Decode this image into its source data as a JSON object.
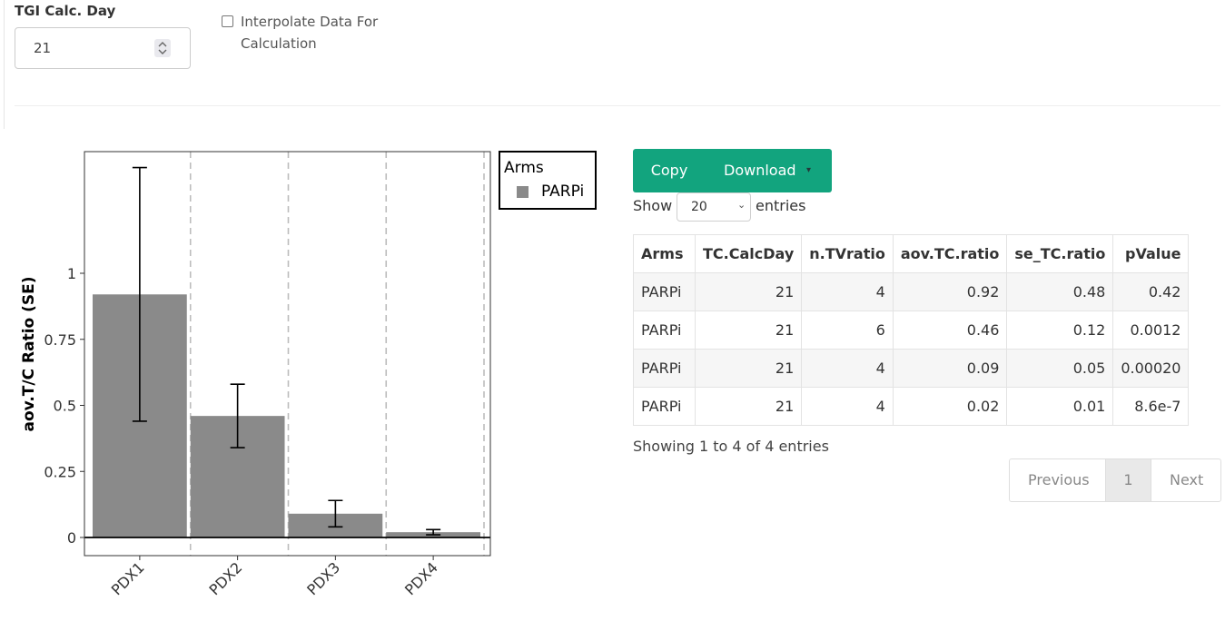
{
  "controls": {
    "tgi_label": "TGI Calc. Day",
    "tgi_value": "21",
    "interpolate_label": "Interpolate Data For Calculation",
    "interpolate_checked": false
  },
  "chart_data": {
    "type": "bar",
    "categories": [
      "PDX1",
      "PDX2",
      "PDX3",
      "PDX4"
    ],
    "series": [
      {
        "name": "PARPi",
        "values": [
          0.92,
          0.46,
          0.09,
          0.02
        ],
        "se": [
          0.48,
          0.12,
          0.05,
          0.01
        ],
        "color": "#8a8a8a"
      }
    ],
    "xlabel": "",
    "ylabel": "aov.T/C Ratio (SE)",
    "ylim": [
      -0.07,
      1.47
    ],
    "yticks": [
      0,
      0.25,
      0.5,
      0.75,
      1
    ],
    "ytick_labels": [
      "0",
      "0.25",
      "0.5",
      "0.75",
      "1"
    ],
    "grid": "dashed vertical",
    "legend": {
      "title": "Arms",
      "position": "top-right",
      "entries": [
        "PARPi"
      ]
    }
  },
  "buttons": {
    "copy": "Copy",
    "download": "Download",
    "caret": "▾"
  },
  "length_menu": {
    "show_label": "Show",
    "selected": "20",
    "chevron": "⌄",
    "entries_label": "entries"
  },
  "table": {
    "headers": [
      "Arms",
      "TC.CalcDay",
      "n.TVratio",
      "aov.TC.ratio",
      "se_TC.ratio",
      "pValue"
    ],
    "rows": [
      [
        "PARPi",
        "21",
        "4",
        "0.92",
        "0.48",
        "0.42"
      ],
      [
        "PARPi",
        "21",
        "6",
        "0.46",
        "0.12",
        "0.0012"
      ],
      [
        "PARPi",
        "21",
        "4",
        "0.09",
        "0.05",
        "0.00020"
      ],
      [
        "PARPi",
        "21",
        "4",
        "0.02",
        "0.01",
        "8.6e-7"
      ]
    ]
  },
  "info": "Showing 1 to 4 of 4 entries",
  "pagination": {
    "previous": "Previous",
    "current": "1",
    "next": "Next"
  }
}
